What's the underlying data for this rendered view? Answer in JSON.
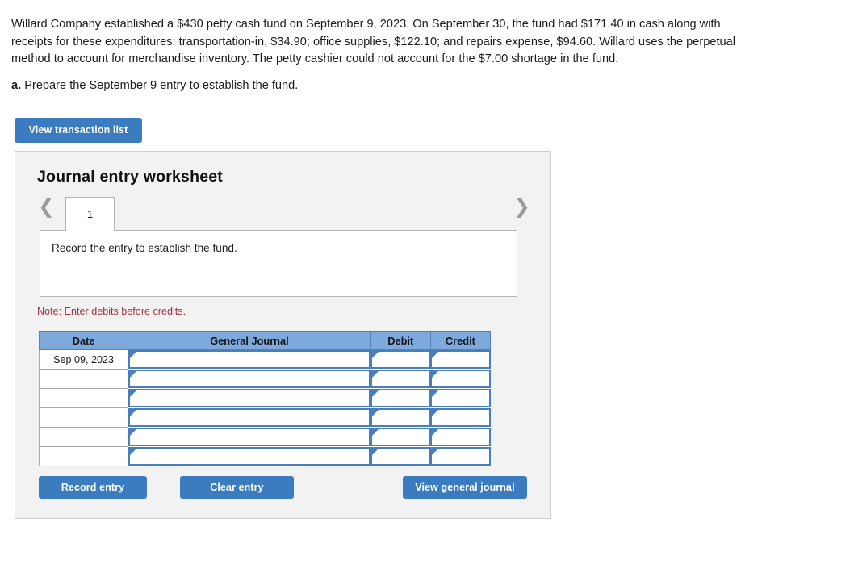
{
  "problem": {
    "text": "Willard Company established a $430 petty cash fund on September 9, 2023. On September 30, the fund had $171.40 in cash along with receipts for these expenditures: transportation-in, $34.90; office supplies, $122.10; and repairs expense, $94.60. Willard uses the perpetual method to account for merchandise inventory. The petty cashier could not account for the $7.00 shortage in the fund."
  },
  "requirement": {
    "label": "a.",
    "text": " Prepare the September 9 entry to establish the fund."
  },
  "toolbar": {
    "view_transaction_list_label": "View transaction list"
  },
  "worksheet": {
    "title": "Journal entry worksheet",
    "prev_icon": "chevron-left-icon",
    "next_icon": "chevron-right-icon",
    "tabs": [
      {
        "label": "1",
        "active": true
      }
    ],
    "prompt": "Record the entry to establish the fund.",
    "note": "Note: Enter debits before credits.",
    "table": {
      "headers": [
        "Date",
        "General Journal",
        "Debit",
        "Credit"
      ],
      "rows": [
        {
          "date": "Sep 09, 2023",
          "general_journal": "",
          "debit": "",
          "credit": ""
        },
        {
          "date": "",
          "general_journal": "",
          "debit": "",
          "credit": ""
        },
        {
          "date": "",
          "general_journal": "",
          "debit": "",
          "credit": ""
        },
        {
          "date": "",
          "general_journal": "",
          "debit": "",
          "credit": ""
        },
        {
          "date": "",
          "general_journal": "",
          "debit": "",
          "credit": ""
        },
        {
          "date": "",
          "general_journal": "",
          "debit": "",
          "credit": ""
        }
      ]
    },
    "buttons": {
      "record_entry_label": "Record entry",
      "clear_entry_label": "Clear entry",
      "view_general_journal_label": "View general journal"
    }
  },
  "colors": {
    "button_blue": "#3b7cc0",
    "table_header_blue": "#7da9dd",
    "cell_border_blue": "#4a7ebb",
    "note_red": "#a5333a",
    "panel_background": "#f2f2f2"
  }
}
